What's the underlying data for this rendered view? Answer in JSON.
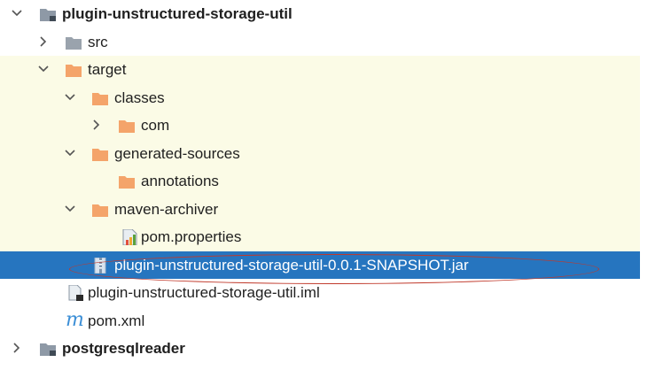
{
  "tree": {
    "module_root": {
      "label": "plugin-unstructured-storage-util"
    },
    "src": {
      "label": "src"
    },
    "target": {
      "label": "target"
    },
    "classes": {
      "label": "classes"
    },
    "com": {
      "label": "com"
    },
    "generated_sources": {
      "label": "generated-sources"
    },
    "annotations": {
      "label": "annotations"
    },
    "maven_archiver": {
      "label": "maven-archiver"
    },
    "pom_properties": {
      "label": "pom.properties"
    },
    "jar": {
      "label": "plugin-unstructured-storage-util-0.0.1-SNAPSHOT.jar",
      "selected": true
    },
    "iml": {
      "label": "plugin-unstructured-storage-util.iml"
    },
    "pom_xml": {
      "label": "pom.xml"
    },
    "next_module": {
      "label": "postgresqlreader"
    }
  },
  "colors": {
    "selection": "#2675bf",
    "excluded_bg": "#fbfbe6",
    "folder": "#f4a46a",
    "module_icon": "#8e99a6",
    "annotation_oval": "#c0392b"
  },
  "icons": {
    "expanded": "chevron-down-icon",
    "collapsed": "chevron-right-icon",
    "folder": "folder-icon",
    "module": "module-folder-icon",
    "properties": "properties-file-icon",
    "jar": "jar-file-icon",
    "iml": "iml-file-icon",
    "maven": "maven-pom-icon"
  }
}
